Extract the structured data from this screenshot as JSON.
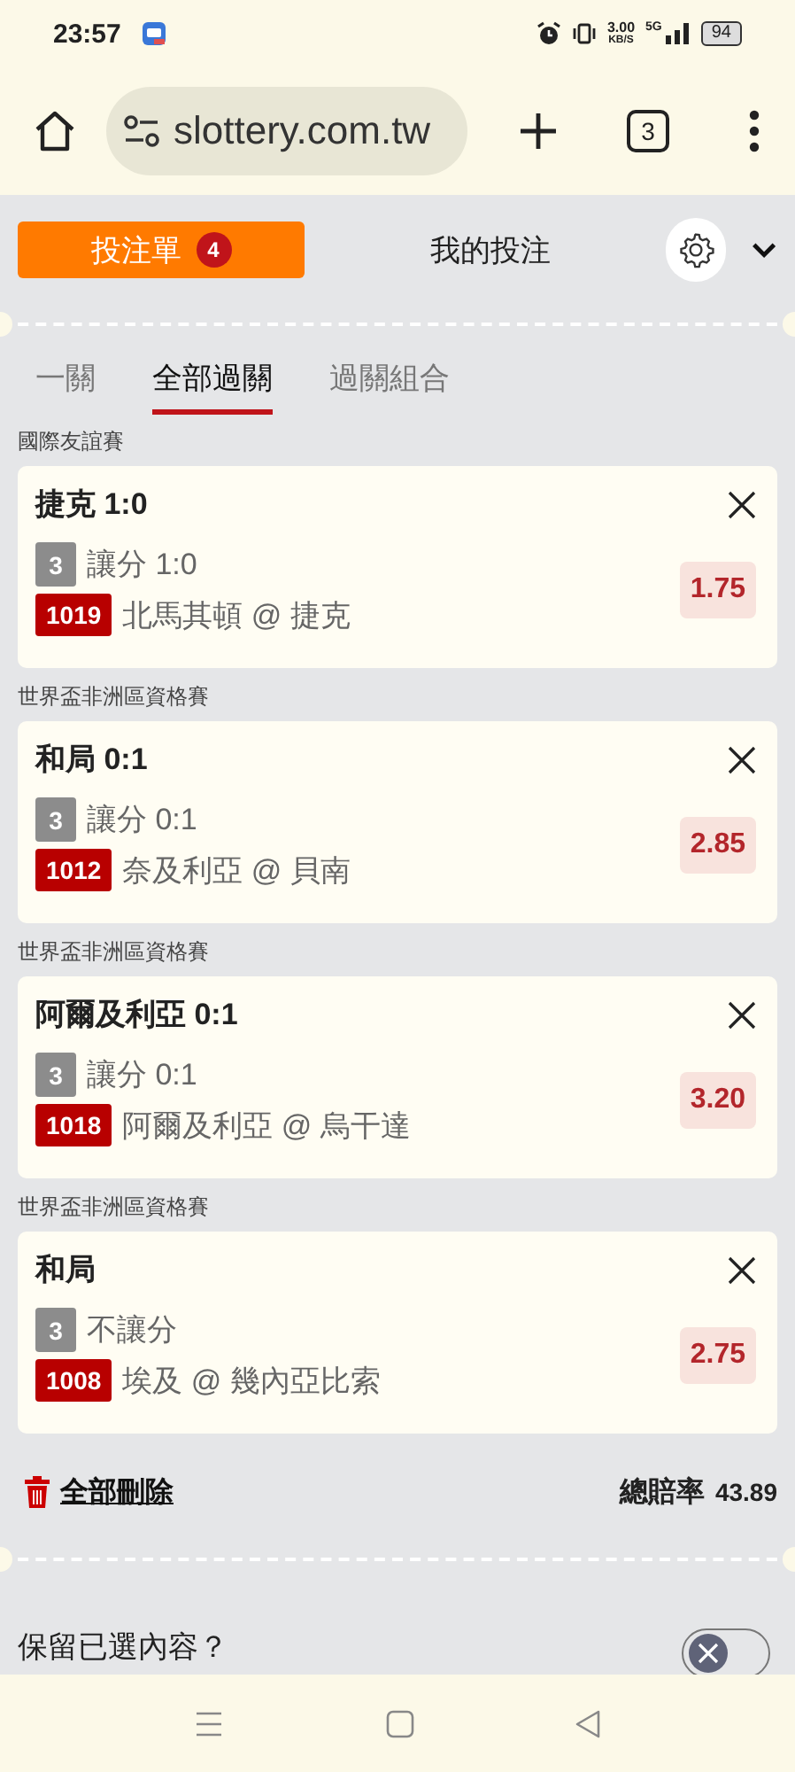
{
  "status_bar": {
    "time": "23:57",
    "network_speed": "3.00",
    "network_unit": "KB/S",
    "network_type": "5G",
    "battery": "94"
  },
  "browser": {
    "url": "slottery.com.tw",
    "tab_count": "3"
  },
  "betslip_tabs": [
    {
      "label": "投注單",
      "badge": "4",
      "selected": true
    },
    {
      "label": "我的投注",
      "selected": false
    }
  ],
  "bet_types": [
    {
      "label": "一關",
      "selected": false
    },
    {
      "label": "全部過關",
      "selected": true
    },
    {
      "label": "過關組合",
      "selected": false
    }
  ],
  "selections": [
    {
      "league": "國際友誼賽",
      "pick": "捷克 1:0",
      "bet_no": "3",
      "market": "讓分 1:0",
      "match_no": "1019",
      "teams": "北馬其頓 @ 捷克",
      "odds": "1.75"
    },
    {
      "league": "世界盃非洲區資格賽",
      "pick": "和局 0:1",
      "bet_no": "3",
      "market": "讓分 0:1",
      "match_no": "1012",
      "teams": "奈及利亞 @ 貝南",
      "odds": "2.85"
    },
    {
      "league": "世界盃非洲區資格賽",
      "pick": "阿爾及利亞 0:1",
      "bet_no": "3",
      "market": "讓分 0:1",
      "match_no": "1018",
      "teams": "阿爾及利亞 @ 烏干達",
      "odds": "3.20"
    },
    {
      "league": "世界盃非洲區資格賽",
      "pick": "和局",
      "bet_no": "3",
      "market": "不讓分",
      "match_no": "1008",
      "teams": "埃及 @ 幾內亞比索",
      "odds": "2.75"
    }
  ],
  "footer": {
    "delete_all": "全部刪除",
    "total_odds_label": "總賠率",
    "total_odds": "43.89"
  },
  "keep_selection": {
    "label": "保留已選內容？",
    "on": false
  }
}
